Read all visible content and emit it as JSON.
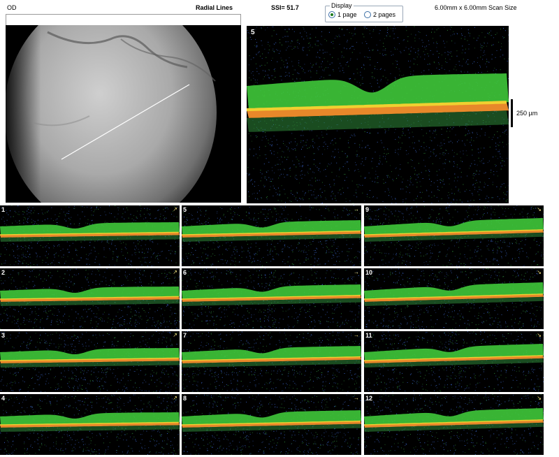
{
  "header": {
    "eye": "OD",
    "scan_type": "Radial Lines",
    "ssi": "SSI= 51.7",
    "scan_size": "6.00mm x 6.00mm Scan Size"
  },
  "display": {
    "legend": "Display",
    "options": [
      {
        "label": "1 page",
        "selected": true
      },
      {
        "label": "2 pages",
        "selected": false
      }
    ]
  },
  "main_scan": {
    "number": "5",
    "scale_label": "250 µm"
  },
  "thumbnails": [
    {
      "number": "1",
      "arrow": "↗"
    },
    {
      "number": "5",
      "arrow": "→"
    },
    {
      "number": "9",
      "arrow": "↘"
    },
    {
      "number": "2",
      "arrow": "↗"
    },
    {
      "number": "6",
      "arrow": "→"
    },
    {
      "number": "10",
      "arrow": "↘"
    },
    {
      "number": "3",
      "arrow": "↗"
    },
    {
      "number": "7",
      "arrow": "→"
    },
    {
      "number": "11",
      "arrow": "↘"
    },
    {
      "number": "4",
      "arrow": "↗"
    },
    {
      "number": "8",
      "arrow": "→"
    },
    {
      "number": "12",
      "arrow": "↘"
    }
  ],
  "colors": {
    "retina_green": "#3fc83a",
    "rpe_orange": "#e8882a",
    "rpe_yellow": "#f0d030",
    "noise_blue": "#3a64c8",
    "background": "#000000"
  }
}
